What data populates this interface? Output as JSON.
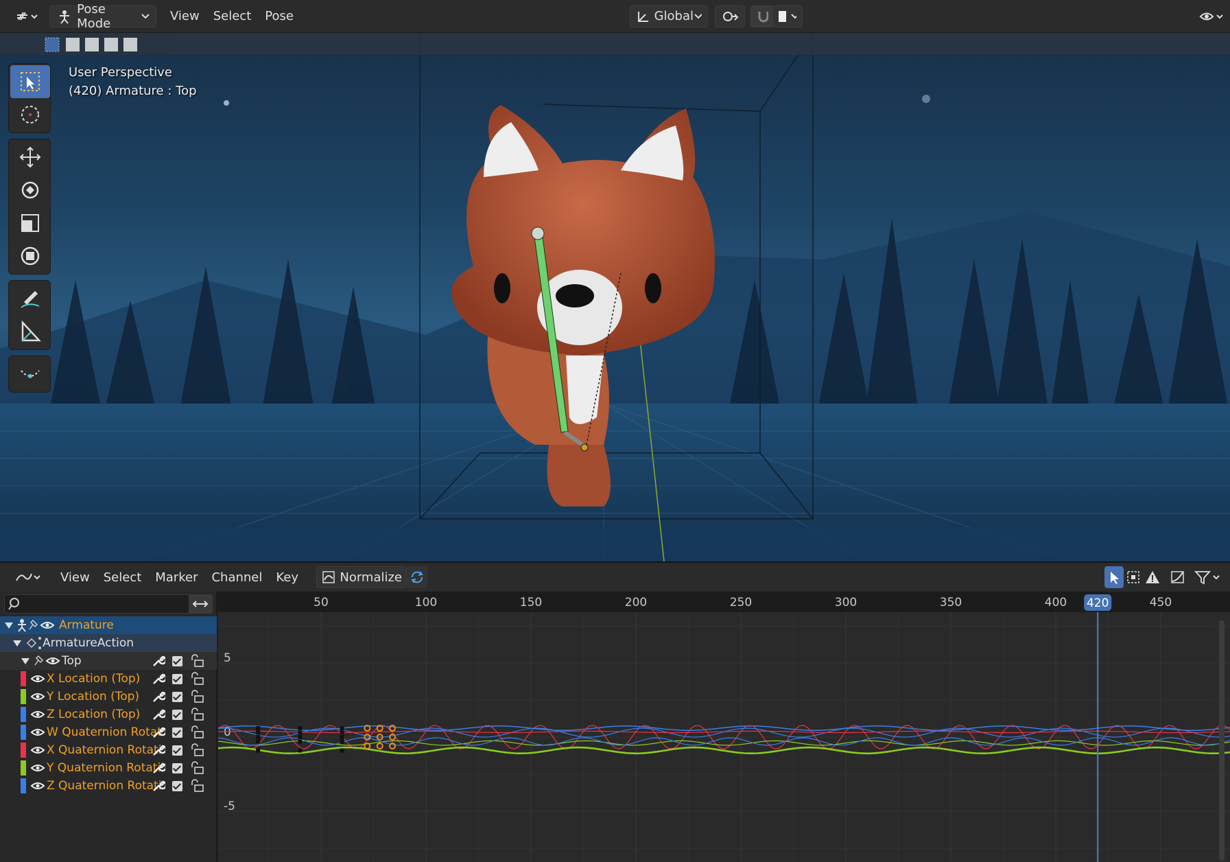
{
  "header": {
    "mode": "Pose Mode",
    "menus": [
      "View",
      "Select",
      "Pose"
    ],
    "transform_orientation": "Global"
  },
  "viewport": {
    "overlay_line1": "User Perspective",
    "overlay_line2": "(420) Armature : Top"
  },
  "graph_editor": {
    "menus": [
      "View",
      "Select",
      "Marker",
      "Channel",
      "Key"
    ],
    "normalize_label": "Normalize",
    "search_value": "",
    "frame_ticks": [
      "50",
      "100",
      "150",
      "200",
      "250",
      "300",
      "350",
      "400",
      "450"
    ],
    "current_frame": "420",
    "value_ticks": [
      "5",
      "0",
      "-5"
    ],
    "channels": [
      {
        "label": "Armature",
        "level": 0,
        "color": ""
      },
      {
        "label": "ArmatureAction",
        "level": 1,
        "color": ""
      },
      {
        "label": "Top",
        "level": 2,
        "color": ""
      },
      {
        "label": "X Location (Top)",
        "level": 3,
        "color": "#e8324a"
      },
      {
        "label": "Y Location (Top)",
        "level": 3,
        "color": "#8ccc1c"
      },
      {
        "label": "Z Location (Top)",
        "level": 3,
        "color": "#3880e8"
      },
      {
        "label": "W Quaternion Rotat",
        "level": 3,
        "color": "#3880e8"
      },
      {
        "label": "X Quaternion Rotati",
        "level": 3,
        "color": "#e8324a"
      },
      {
        "label": "Y Quaternion Rotati",
        "level": 3,
        "color": "#8ccc1c"
      },
      {
        "label": "Z Quaternion Rotati",
        "level": 3,
        "color": "#3880e8"
      }
    ]
  },
  "colors": {
    "accent": "#4772b3",
    "channel_text": "#f0a028",
    "selected_key": "#f08c1e"
  }
}
